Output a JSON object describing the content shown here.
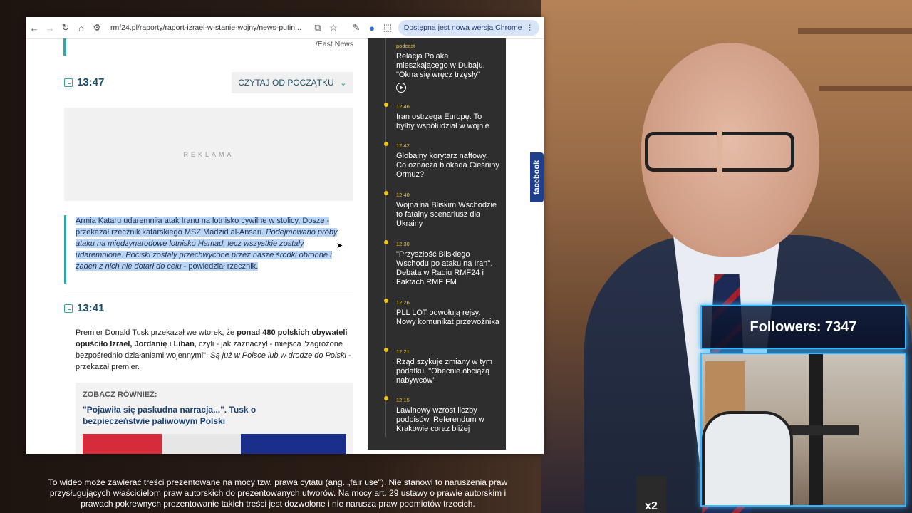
{
  "browser": {
    "url": "rmf24.pl/raporty/raport-izrael-w-stanie-wojny/news-putin...",
    "update_label": "Dostępna jest nowa wersja Chrome"
  },
  "article": {
    "photo_credit": "/East News",
    "entry1": {
      "time": "13:47",
      "read_from_start": "CZYTAJ OD POCZĄTKU",
      "ad_label": "REKLAMA",
      "text_normal": "Armia Kataru udaremniła atak Iranu na lotnisko cywilne w stolicy, Dosze - przekazał rzecznik katarskiego MSZ Madżid al-Ansari. ",
      "text_italic": "Podejmowano próby ataku na międzynarodowe lotnisko Hamad, lecz wszystkie zostały udaremnione. Pociski zostały przechwycone przez nasze środki obronne i żaden z nich nie dotarł do celu",
      "text_end": " - powiedział rzecznik."
    },
    "entry2": {
      "time": "13:41",
      "text_a": "Premier Donald Tusk przekazał we wtorek, że ",
      "text_bold": "ponad 480 polskich obywateli opuściło Izrael, Jordanię i Liban",
      "text_b": ", czyli - jak zaznaczył - miejsca \"zagrożone bezpośrednio działaniami wojennymi\". ",
      "text_italic": "Są już w Polsce lub w drodze do Polski",
      "text_c": " - przekazał premier.",
      "see_also_title": "ZOBACZ RÓWNIEŻ:",
      "see_also_link": "\"Pojawiła się paskudna narracja...\". Tusk o bezpieczeństwie paliwowym Polski"
    }
  },
  "timeline": [
    {
      "time": "podcast",
      "title": "Relacja Polaka mieszkającego w Dubaju. \"Okna się wręcz trzęsły\""
    },
    {
      "time": "12:46",
      "title": "Iran ostrzega Europę. To byłby współudział w wojnie"
    },
    {
      "time": "12:42",
      "title": "Globalny korytarz naftowy. Co oznacza blokada Cieśniny Ormuz?"
    },
    {
      "time": "12:40",
      "title": "Wojna na Bliskim Wschodzie to fatalny scenariusz dla Ukrainy"
    },
    {
      "time": "12:30",
      "title": "\"Przyszłość Bliskiego Wschodu po ataku na Iran\". Debata w Radiu RMF24 i Faktach RMF FM"
    },
    {
      "time": "12:26",
      "title": "PLL LOT odwołują rejsy. Nowy komunikat przewoźnika"
    },
    {
      "time": "12:21",
      "title": "Rząd szykuje zmiany w tym podatku. \"Obecnie obciążą nabywców\""
    },
    {
      "time": "12:15",
      "title": "Lawinowy wzrost liczby podpisów. Referendum w Krakowie coraz bliżej"
    }
  ],
  "facebook_tab": "facebook",
  "stream": {
    "followers": "Followers: 7347",
    "multiplier": "x2"
  },
  "disclaimer": "To wideo może zawierać treści prezentowane na mocy tzw. prawa cytatu (ang. „fair use\"). Nie stanowi to naruszenia praw przysługujących właścicielom praw autorskich do prezentowanych utworów. Na mocy art. 29 ustawy o prawie autorskim i prawach pokrewnych prezentowanie takich treści jest dozwolone i nie narusza praw podmiotów trzecich.",
  "colors": {
    "accent": "#2fa7a2",
    "timeline_time": "#f0c419",
    "followers_border": "#39b6ff"
  }
}
